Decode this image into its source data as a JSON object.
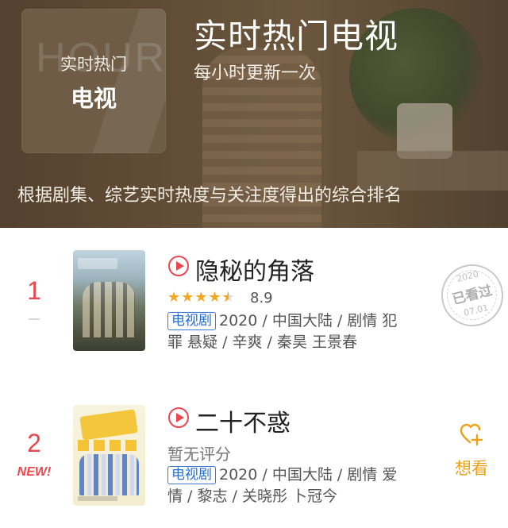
{
  "header": {
    "badge_watermark": "HOUR",
    "badge_line1": "实时热门",
    "badge_line2": "电视",
    "title": "实时热门电视",
    "subtitle": "每小时更新一次",
    "description": "根据剧集、综艺实时热度与关注度得出的综合排名"
  },
  "items": [
    {
      "rank": "1",
      "rank_change": "—",
      "title": "隐秘的角落",
      "rating": "8.9",
      "rating_stars": 4.5,
      "tag": "电视剧",
      "meta_line1": "2020 / 中国大陆 / 剧情 犯",
      "meta_line2": "罪 悬疑 / 辛爽 / 秦昊 王景春",
      "stamp": {
        "year": "2020",
        "label": "已看过",
        "date": "07.01"
      }
    },
    {
      "rank": "2",
      "rank_change": "NEW!",
      "title": "二十不惑",
      "rating_text": "暂无评分",
      "tag": "电视剧",
      "meta_line1": "2020 / 中国大陆 / 剧情 爱",
      "meta_line2": "情 / 黎志 / 关晓彤 卜冠今",
      "action_label": "想看"
    }
  ],
  "colors": {
    "accent_red": "#e9484f",
    "tag_blue": "#2a6fce",
    "star": "#f5a623",
    "want_orange": "#e9a21c"
  }
}
